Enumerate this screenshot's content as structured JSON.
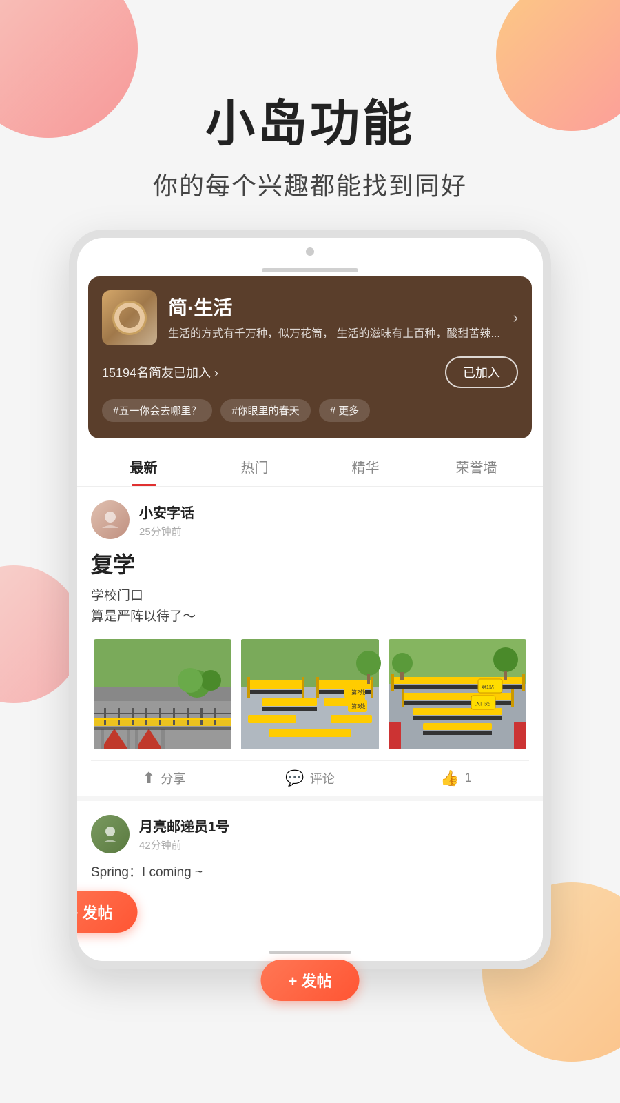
{
  "page": {
    "bg_circle_colors": {
      "top_left": "#f87070",
      "top_right": "#ff6b6b",
      "mid_left": "#f9b4a8",
      "bottom_right": "#ffa040"
    },
    "header": {
      "main_title": "小岛功能",
      "sub_title": "你的每个兴趣都能找到同好"
    },
    "phone": {
      "island_card": {
        "name": "简·生活",
        "description": "生活的方式有千万种，似万花筒，\n生活的滋味有上百种，酸甜苦辣...",
        "members_text": "15194名简友已加入 ›",
        "join_btn_label": "已加入",
        "tags": [
          "#五一你会去哪里？",
          "#你眼里的春天",
          "# 更多"
        ]
      },
      "tabs": [
        {
          "label": "最新",
          "active": true
        },
        {
          "label": "热门",
          "active": false
        },
        {
          "label": "精华",
          "active": false
        },
        {
          "label": "荣誉墙",
          "active": false
        }
      ],
      "post1": {
        "author_name": "小安字话",
        "post_time": "25分钟前",
        "title": "复学",
        "body_line1": "学校门口",
        "body_line2": "算是严阵以待了～",
        "actions": {
          "share": "分享",
          "comment": "评论",
          "like": "1"
        }
      },
      "post2": {
        "author_name": "月亮邮递员1号",
        "post_time": "42分钟前",
        "body_text": "Spring：I coming ~"
      },
      "fab": {
        "label": "+ 发帖"
      }
    }
  }
}
